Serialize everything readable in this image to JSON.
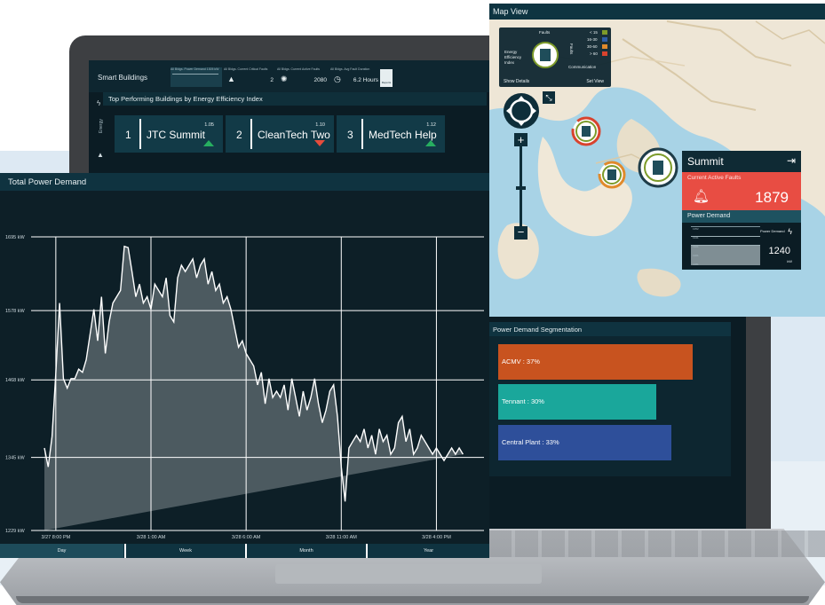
{
  "colors": {
    "panel_bg": "#0d1f27",
    "title_bar": "#0f3340",
    "accent_green": "#27ae60",
    "accent_red": "#e74c3c",
    "fault_red": "#e84d43",
    "acmv": "#c8531f",
    "tennant": "#1aa79b",
    "central_plant": "#2e4f9a"
  },
  "smart_buildings": {
    "title": "Smart Buildings",
    "stats": [
      {
        "label": "All Bldgs. Power Demand 1305 kW",
        "value": "",
        "icon": "sparkline-icon"
      },
      {
        "label": "All Bldgs. Current Critical Faults",
        "value": "2",
        "icon": "warning-icon"
      },
      {
        "label": "All Bldgs. Current Active Faults",
        "value": "2080",
        "icon": "alarm-icon"
      },
      {
        "label": "All Bldgs. Avg Fault Duration",
        "value": "6.2 Hours",
        "icon": "clock-icon"
      }
    ],
    "report_label": "Reports",
    "side_label": "Energy",
    "top_title": "Top Performing Buildings by Energy Efficiency Index",
    "rankings": [
      {
        "rank": "1",
        "name": "JTC Summit",
        "value": "1.05",
        "trend": "up"
      },
      {
        "rank": "2",
        "name": "CleanTech Two",
        "value": "1.10",
        "trend": "down"
      },
      {
        "rank": "3",
        "name": "MedTech Help",
        "value": "1.12",
        "trend": "up"
      }
    ]
  },
  "segmentation": {
    "title": "Power Demand Segmentation",
    "bars": [
      {
        "label": "ACMV : 37%",
        "value": 37
      },
      {
        "label": "Tennant : 30%",
        "value": 30
      },
      {
        "label": "Central Plant : 33%",
        "value": 33
      }
    ]
  },
  "map_view": {
    "title": "Map View",
    "legend": {
      "faults_label": "Faults",
      "faults_side": "Faults",
      "eei_label": [
        "Energy",
        "Efficiency",
        "Index"
      ],
      "communication_label": "Communication",
      "ranges": [
        {
          "label": "< 15",
          "color": "#7d9b2a"
        },
        {
          "label": "16-30",
          "color": "#2e5ea8"
        },
        {
          "label": "30-60",
          "color": "#e08a2c"
        },
        {
          "label": "> 60",
          "color": "#d8432e"
        }
      ],
      "show_details": "Show Details",
      "set_view": "Set View"
    },
    "popup": {
      "title": "Summit",
      "faults_label": "Current Active Faults",
      "faults_value": "1879",
      "power_label": "Power Demand",
      "power_unit_label": "Power Demand",
      "power_value": "1240",
      "power_unit": "kW",
      "mini_ticks": [
        "1352",
        "1341",
        "1321",
        "1301",
        "1281"
      ]
    }
  },
  "total_power": {
    "title": "Total Power Demand",
    "tabs": [
      "Day",
      "Week",
      "Month",
      "Year"
    ],
    "active_tab": "Day"
  },
  "chart_data": {
    "type": "area",
    "title": "Total Power Demand",
    "y_unit": "kW",
    "ylim": [
      1229,
      1695
    ],
    "y_ticks": [
      "1695 kW",
      "1578 kW",
      "1468 kW",
      "1345 kW",
      "1229 kW"
    ],
    "y_tick_values": [
      1695,
      1578,
      1468,
      1345,
      1229
    ],
    "x_ticks": [
      "3/27 8:00 PM",
      "3/28 1:00 AM",
      "3/28 6:00 AM",
      "3/28 11:00 AM",
      "3/28 4:00 PM"
    ],
    "x_tick_hours": [
      0,
      5,
      10,
      15,
      20
    ],
    "grid": true,
    "x_hours": [
      -0.6,
      -0.4,
      -0.2,
      0,
      0.2,
      0.4,
      0.6,
      0.8,
      1,
      1.2,
      1.4,
      1.6,
      1.8,
      2,
      2.2,
      2.4,
      2.6,
      2.8,
      3,
      3.2,
      3.4,
      3.6,
      3.8,
      4,
      4.2,
      4.4,
      4.6,
      4.8,
      5,
      5.2,
      5.4,
      5.6,
      5.8,
      6,
      6.2,
      6.4,
      6.6,
      6.8,
      7,
      7.2,
      7.4,
      7.6,
      7.8,
      8,
      8.2,
      8.4,
      8.6,
      8.8,
      9,
      9.2,
      9.4,
      9.6,
      9.8,
      10,
      10.2,
      10.4,
      10.6,
      10.8,
      11,
      11.2,
      11.4,
      11.6,
      11.8,
      12,
      12.2,
      12.4,
      12.6,
      12.8,
      13,
      13.2,
      13.4,
      13.6,
      13.8,
      14,
      14.2,
      14.4,
      14.6,
      14.8,
      15,
      15.2,
      15.4,
      15.6,
      15.8,
      16,
      16.2,
      16.4,
      16.6,
      16.8,
      17,
      17.2,
      17.4,
      17.6,
      17.8,
      18,
      18.2,
      18.4,
      18.6,
      18.8,
      19,
      19.2,
      19.4,
      19.6,
      19.8,
      20,
      20.2,
      20.4,
      20.6,
      20.8,
      21,
      21.2,
      21.4,
      21.6,
      21.8,
      22,
      22.2,
      22.4
    ],
    "values": [
      1360,
      1330,
      1378,
      1480,
      1590,
      1470,
      1455,
      1470,
      1470,
      1485,
      1480,
      1500,
      1540,
      1580,
      1530,
      1600,
      1510,
      1560,
      1590,
      1600,
      1610,
      1680,
      1678,
      1640,
      1600,
      1620,
      1590,
      1600,
      1580,
      1620,
      1610,
      1600,
      1630,
      1570,
      1560,
      1630,
      1650,
      1640,
      1650,
      1660,
      1630,
      1650,
      1660,
      1620,
      1640,
      1610,
      1620,
      1590,
      1600,
      1580,
      1550,
      1520,
      1530,
      1510,
      1500,
      1490,
      1460,
      1480,
      1430,
      1470,
      1440,
      1450,
      1440,
      1460,
      1420,
      1470,
      1440,
      1410,
      1450,
      1420,
      1440,
      1470,
      1430,
      1400,
      1420,
      1450,
      1460,
      1410,
      1330,
      1275,
      1360,
      1370,
      1380,
      1370,
      1390,
      1360,
      1380,
      1350,
      1390,
      1370,
      1380,
      1350,
      1360,
      1400,
      1410,
      1370,
      1390,
      1350,
      1360,
      1380,
      1370,
      1360,
      1350,
      1360,
      1350,
      1340,
      1350,
      1360,
      1350,
      1360,
      1350
    ]
  }
}
